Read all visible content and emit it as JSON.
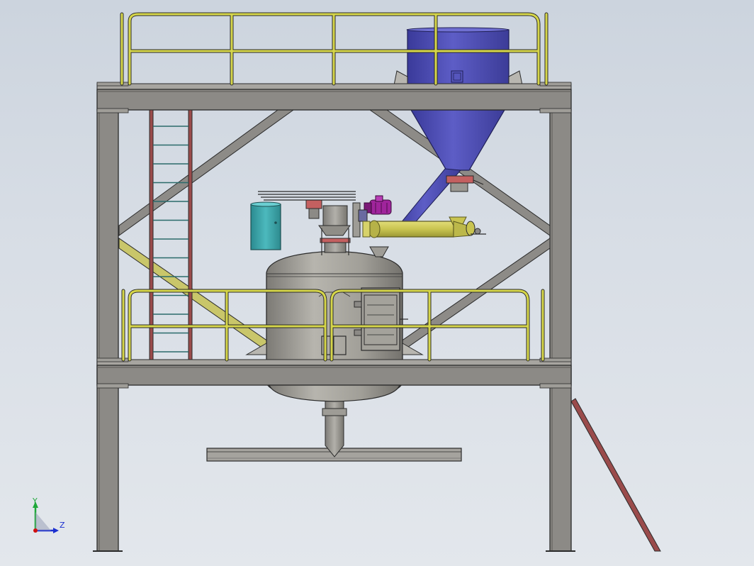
{
  "triad": {
    "y_label": "Y",
    "z_label": "Z",
    "y_color": "#1fa83a",
    "z_color": "#1b2fd0",
    "origin_color": "#d01010"
  },
  "colors": {
    "background_top": "#ccd4de",
    "background_bottom": "#e3e7ec",
    "steel": "#8c8a86",
    "steel_dark": "#2b2b2b",
    "handrail": "#d6d64a",
    "ladder": "#9a4b4b",
    "hopper": "#4e4eb2",
    "vessel": "#9a9892",
    "tank": "#3aa3a7",
    "screw_conveyor": "#c8c44e",
    "motor": "#a0249c",
    "valve_flange": "#c46060"
  }
}
